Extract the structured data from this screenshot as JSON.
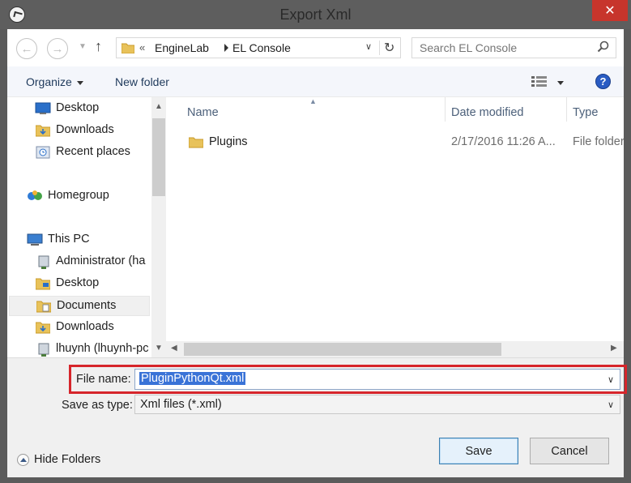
{
  "window": {
    "title": "Export Xml",
    "close_glyph": "✕",
    "app_icon": "app-logo-icon"
  },
  "address": {
    "overflow_glyph": "«",
    "crumbs": [
      "EngineLab",
      "EL Console"
    ],
    "refresh_glyph": "↻"
  },
  "search": {
    "placeholder": "Search EL Console"
  },
  "toolbar": {
    "organize_label": "Organize",
    "new_folder_label": "New folder",
    "help_glyph": "?"
  },
  "nav_pane": {
    "items": [
      {
        "label": "Desktop",
        "icon": "desktop-icon",
        "indent": 1
      },
      {
        "label": "Downloads",
        "icon": "downloads-folder-icon",
        "indent": 1
      },
      {
        "label": "Recent places",
        "icon": "recent-places-icon",
        "indent": 1
      },
      {
        "label": "Homegroup",
        "icon": "homegroup-icon",
        "indent": 0
      },
      {
        "label": "This PC",
        "icon": "this-pc-icon",
        "indent": 0
      },
      {
        "label": "Administrator (ha",
        "icon": "network-drive-icon",
        "indent": 1
      },
      {
        "label": "Desktop",
        "icon": "folder-icon",
        "indent": 1
      },
      {
        "label": "Documents",
        "icon": "documents-folder-icon",
        "indent": 1,
        "selected": true
      },
      {
        "label": "Downloads",
        "icon": "downloads-folder-icon",
        "indent": 1
      },
      {
        "label": "lhuynh (lhuynh-pc",
        "icon": "network-drive-icon",
        "indent": 1
      }
    ]
  },
  "file_list": {
    "columns": [
      "Name",
      "Date modified",
      "Type"
    ],
    "rows": [
      {
        "name": "Plugins",
        "date": "2/17/2016 11:26 A...",
        "type": "File folder",
        "icon": "folder-icon"
      }
    ]
  },
  "save_panel": {
    "file_name_label": "File name:",
    "file_name_value": "PluginPythonQt.xml",
    "save_as_type_label": "Save as type:",
    "save_as_type_value": "Xml files (*.xml)",
    "hide_folders_label": "Hide Folders",
    "save_label": "Save",
    "cancel_label": "Cancel"
  },
  "colors": {
    "highlight_box": "#d6252b",
    "selection": "#3a73d7",
    "close_button": "#c7352c"
  }
}
